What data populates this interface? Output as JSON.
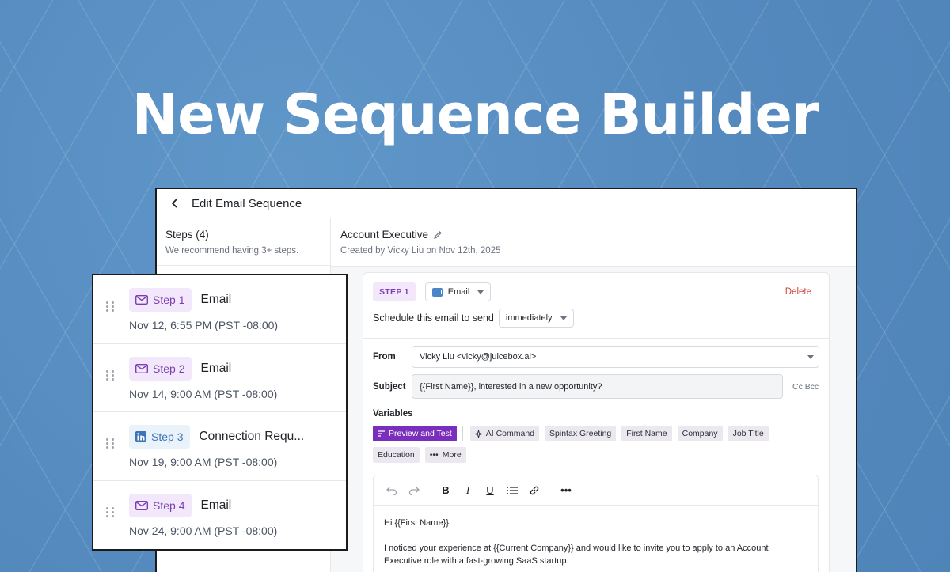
{
  "hero": {
    "title": "New Sequence Builder"
  },
  "window": {
    "header_title": "Edit Email Sequence",
    "steps_title": "Steps (4)",
    "steps_hint": "We recommend having 3+ steps.",
    "sequence_name": "Account Executive",
    "sequence_meta": "Created by Vicky Liu on Nov 12th, 2025"
  },
  "step_card": {
    "chip": "STEP 1",
    "channel": "Email",
    "delete_label": "Delete",
    "schedule_label": "Schedule this email to send",
    "schedule_value": "immediately",
    "from_label": "From",
    "from_value": "Vicky Liu <vicky@juicebox.ai>",
    "subject_label": "Subject",
    "subject_value": "{{First Name}}, interested in a new opportunity?",
    "cc_bcc": "Cc Bcc",
    "variables_label": "Variables",
    "variables": {
      "preview": "Preview and Test",
      "ai": "AI Command",
      "spintax": "Spintax Greeting",
      "first_name": "First Name",
      "company": "Company",
      "job_title": "Job Title",
      "education": "Education",
      "more": "More"
    },
    "body": {
      "greeting": "Hi {{First Name}},",
      "paragraph": "I noticed your experience at {{Current Company}} and would like to invite you to apply to an Account Executive role with a fast-growing SaaS startup."
    }
  },
  "steps": [
    {
      "badge": "Step 1",
      "type": "Email",
      "date": "Nov 12, 6:55 PM (PST -08:00)",
      "icon": "mail-icon"
    },
    {
      "badge": "Step 2",
      "type": "Email",
      "date": "Nov 14, 9:00 AM (PST -08:00)",
      "icon": "mail-icon"
    },
    {
      "badge": "Step 3",
      "type": "Connection Requ...",
      "date": "Nov 19, 9:00 AM (PST -08:00)",
      "icon": "linkedin-icon"
    },
    {
      "badge": "Step 4",
      "type": "Email",
      "date": "Nov 24, 9:00 AM (PST -08:00)",
      "icon": "mail-icon"
    }
  ],
  "colors": {
    "accent_purple": "#7a2fbc",
    "delete_red": "#d0443a",
    "background_blue": "#5a8fc2"
  }
}
